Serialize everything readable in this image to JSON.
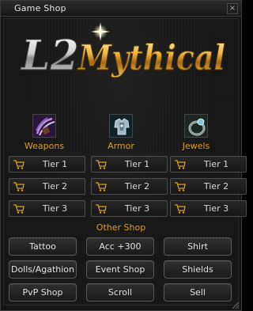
{
  "window": {
    "title": "Game Shop",
    "close_label": "×"
  },
  "logo": {
    "text_l2": "L2",
    "text_mythical": "Mythical"
  },
  "categories": [
    {
      "label": "Weapons",
      "icon": "claw-weapon-icon",
      "tiers": [
        "Tier 1",
        "Tier 2",
        "Tier 3"
      ]
    },
    {
      "label": "Armor",
      "icon": "armor-icon",
      "tiers": [
        "Tier 1",
        "Tier 2",
        "Tier 3"
      ]
    },
    {
      "label": "Jewels",
      "icon": "ring-icon",
      "tiers": [
        "Tier 1",
        "Tier 2",
        "Tier 3"
      ]
    }
  ],
  "other_shop": {
    "title": "Other Shop",
    "buttons": [
      "Tattoo",
      "Acc +300",
      "Shirt",
      "Dolls/Agathion",
      "Event Shop",
      "Shields",
      "PvP Shop",
      "Scroll",
      "Sell"
    ]
  },
  "colors": {
    "accent": "#d9a020",
    "text": "#e0e0e0",
    "background": "#161616"
  }
}
